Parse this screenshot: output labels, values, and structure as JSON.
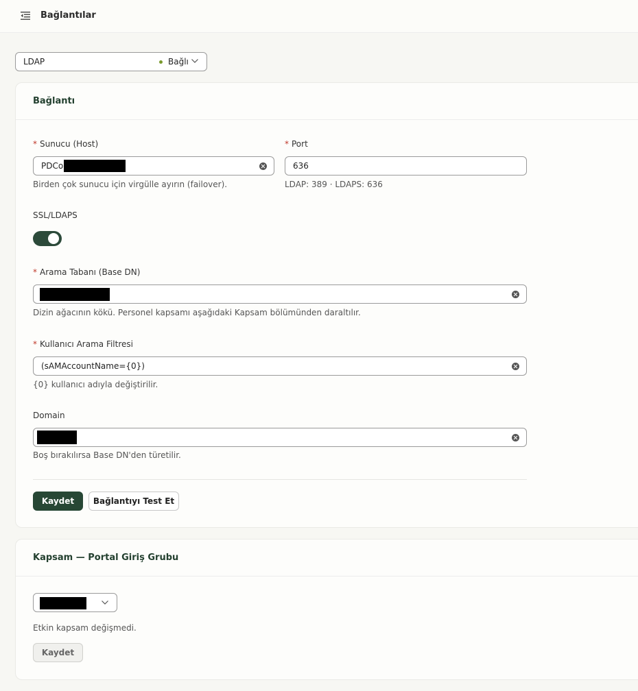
{
  "header": {
    "title": "Bağlantılar",
    "menu_icon": "menu-collapse-icon"
  },
  "connection_select": {
    "value": "LDAP",
    "status": "Bağlı",
    "status_color": "#7a9a2e"
  },
  "connection_card": {
    "title": "Bağlantı",
    "host": {
      "label": "Sunucu (Host)",
      "required_mark": "*",
      "value": "PDCo",
      "redacted": true,
      "hint": "Birden çok sunucu için virgülle ayırın (failover)."
    },
    "port": {
      "label": "Port",
      "required_mark": "*",
      "value": "636",
      "hint": "LDAP: 389 · LDAPS: 636"
    },
    "ssl": {
      "label": "SSL/LDAPS",
      "enabled": true
    },
    "base_dn": {
      "label": "Arama Tabanı (Base DN)",
      "required_mark": "*",
      "value": "",
      "redacted": true,
      "hint": "Dizin ağacının kökü. Personel kapsamı aşağıdaki Kapsam bölümünden daraltılır."
    },
    "user_filter": {
      "label": "Kullanıcı Arama Filtresi",
      "required_mark": "*",
      "value": "(sAMAccountName={0})",
      "hint": "{0} kullanıcı adıyla değiştirilir."
    },
    "domain": {
      "label": "Domain",
      "value": "",
      "redacted": true,
      "hint": "Boş bırakılırsa Base DN'den türetilir."
    },
    "save_label": "Kaydet",
    "test_label": "Bağlantıyı Test Et"
  },
  "scope_card": {
    "title": "Kapsam — Portal Giriş Grubu",
    "group_select": {
      "value": "",
      "redacted": true
    },
    "status_text": "Etkin kapsam değişmedi.",
    "save_label": "Kaydet"
  },
  "colors": {
    "accent": "#274735",
    "required": "#c0392b"
  }
}
